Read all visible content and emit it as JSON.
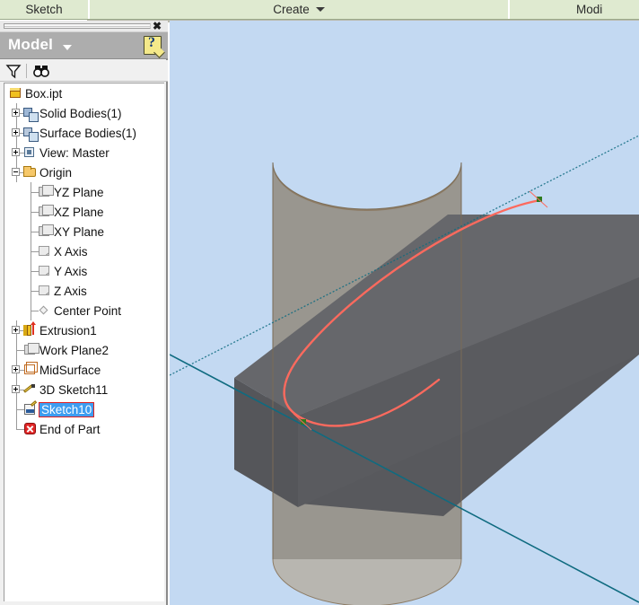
{
  "ribbon": {
    "panels": [
      {
        "label": "Sketch",
        "has_dropdown": false
      },
      {
        "label": "Create",
        "has_dropdown": true
      },
      {
        "label": "Modi",
        "has_dropdown": false
      }
    ]
  },
  "browser": {
    "title": "Model",
    "title_dropdown": "▾",
    "close_label": "✖",
    "help_icon": "help-question-icon",
    "tools": [
      {
        "name": "filter-icon",
        "label": "Filter"
      },
      {
        "name": "find-icon",
        "label": "Find"
      }
    ],
    "tree": [
      {
        "label": "Box.ipt",
        "depth": 0,
        "icon": "part-box-icon",
        "expander": "none",
        "selected": false
      },
      {
        "label": "Solid Bodies(1)",
        "depth": 1,
        "icon": "solid-bodies-icon",
        "expander": "plus",
        "selected": false
      },
      {
        "label": "Surface Bodies(1)",
        "depth": 1,
        "icon": "surface-bodies-icon",
        "expander": "plus",
        "selected": false
      },
      {
        "label": "View: Master",
        "depth": 1,
        "icon": "view-icon",
        "expander": "plus",
        "selected": false
      },
      {
        "label": "Origin",
        "depth": 1,
        "icon": "folder-icon",
        "expander": "minus",
        "selected": false
      },
      {
        "label": "YZ Plane",
        "depth": 2,
        "icon": "plane-icon",
        "expander": "none",
        "selected": false
      },
      {
        "label": "XZ Plane",
        "depth": 2,
        "icon": "plane-icon",
        "expander": "none",
        "selected": false
      },
      {
        "label": "XY Plane",
        "depth": 2,
        "icon": "plane-icon",
        "expander": "none",
        "selected": false
      },
      {
        "label": "X Axis",
        "depth": 2,
        "icon": "axis-icon",
        "expander": "none",
        "selected": false
      },
      {
        "label": "Y Axis",
        "depth": 2,
        "icon": "axis-icon",
        "expander": "none",
        "selected": false
      },
      {
        "label": "Z Axis",
        "depth": 2,
        "icon": "axis-icon",
        "expander": "none",
        "selected": false
      },
      {
        "label": "Center Point",
        "depth": 2,
        "icon": "center-point-icon",
        "expander": "none",
        "selected": false
      },
      {
        "label": "Extrusion1",
        "depth": 1,
        "icon": "extrusion-icon",
        "expander": "plus",
        "selected": false
      },
      {
        "label": "Work Plane2",
        "depth": 1,
        "icon": "work-plane-icon",
        "expander": "none",
        "selected": false
      },
      {
        "label": "MidSurface",
        "depth": 1,
        "icon": "midsurface-icon",
        "expander": "plus",
        "selected": false
      },
      {
        "label": "3D Sketch11",
        "depth": 1,
        "icon": "sketch-3d-icon",
        "expander": "plus",
        "selected": false
      },
      {
        "label": "Sketch10",
        "depth": 1,
        "icon": "sketch-icon",
        "expander": "none",
        "selected": true
      },
      {
        "label": "End of Part",
        "depth": 1,
        "icon": "end-of-part-icon",
        "expander": "none",
        "selected": false
      }
    ]
  },
  "viewport": {
    "background_color": "#c3d9f2",
    "entities": [
      {
        "name": "cylinder-surface",
        "color": "#8d7c65",
        "shade_color": "#a0a0a0"
      },
      {
        "name": "extruded-box",
        "color": "#58595d",
        "top_color": "#6a6b6f"
      },
      {
        "name": "sketch-curve",
        "color": "#fd6a5e"
      },
      {
        "name": "work-axis-line",
        "color": "#0f6b80"
      },
      {
        "name": "intersection-point",
        "color": "#2e7a1e"
      }
    ]
  },
  "colors": {
    "ribbon_bg": "#dfead0",
    "panel_header": "#adadad",
    "selection_blue": "#3e9df0",
    "selection_border": "#e02020",
    "viewport_bg": "#c3d9f2",
    "curve_red": "#fd6a5e",
    "axis_teal": "#0f6b80"
  }
}
